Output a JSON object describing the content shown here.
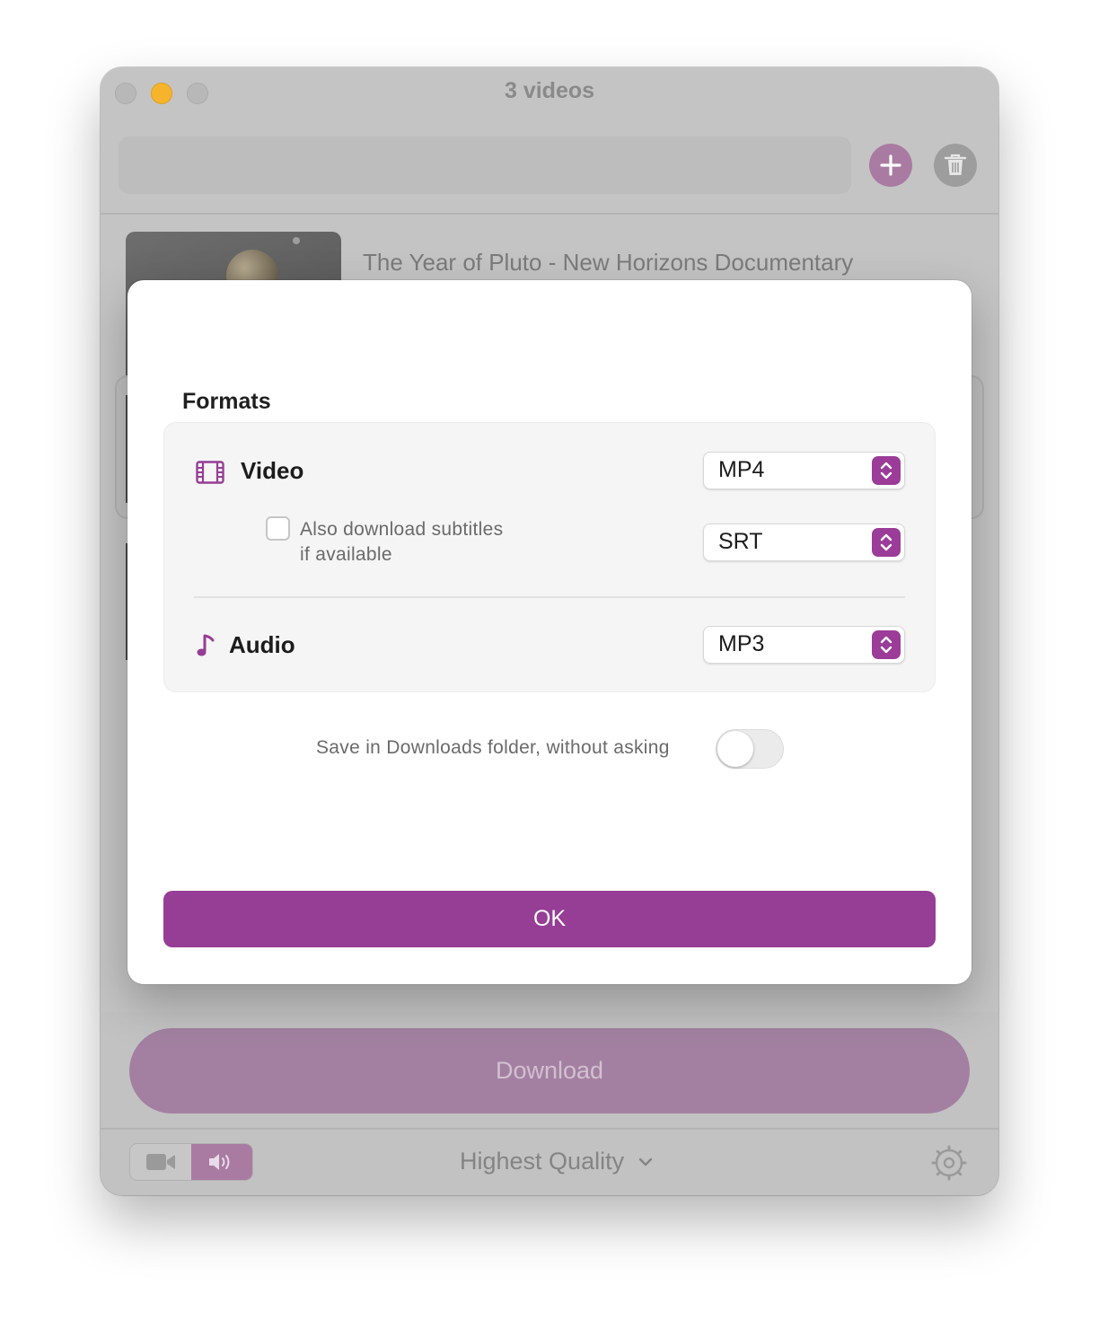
{
  "window": {
    "title": "3 videos"
  },
  "toolbar": {
    "url_value": "",
    "add_icon": "plus-icon",
    "trash_icon": "trash-icon"
  },
  "video_list": {
    "items": [
      {
        "title": "The Year of Pluto - New Horizons Documentary"
      }
    ]
  },
  "dialog": {
    "heading": "Formats",
    "video": {
      "label": "Video",
      "icon": "film-icon",
      "format": "MP4",
      "subtitles_label_line1": "Also download subtitles",
      "subtitles_label_line2": "if available",
      "subtitles_checked": false,
      "subtitles_format": "SRT"
    },
    "audio": {
      "label": "Audio",
      "icon": "music-note-icon",
      "format": "MP3"
    },
    "save_label": "Save in Downloads folder, without asking",
    "save_toggle_on": false,
    "ok_label": "OK"
  },
  "footer": {
    "download_label": "Download",
    "quality_label": "Highest Quality",
    "mode_selected": "audio"
  },
  "colors": {
    "accent": "#963d95",
    "accent_dimmed": "#a380a1"
  }
}
